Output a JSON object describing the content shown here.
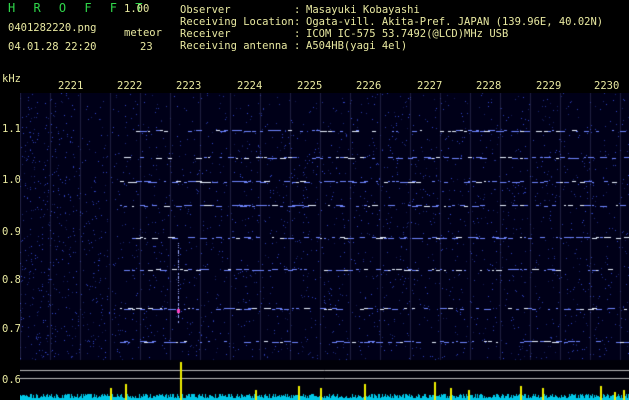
{
  "header": {
    "title": "H R O F F T",
    "version": "1.00",
    "filename": "0401282220.png",
    "datetime": "04.01.28 22:20",
    "meteor_label": "meteor",
    "meteor_count": "23"
  },
  "info": [
    {
      "label": "Observer",
      "value": "Masayuki Kobayashi"
    },
    {
      "label": "Receiving Location",
      "value": "Ogata-vill. Akita-Pref. JAPAN (139.96E, 40.02N)"
    },
    {
      "label": "Receiver",
      "value": "ICOM IC-575 53.7492(@LCD)MHz USB"
    },
    {
      "label": "Receiving antenna",
      "value": "A504HB(yagi 4el)"
    }
  ],
  "colon": ":",
  "spectrogram": {
    "frequency_unit": "kHz",
    "time_labels": [
      "2221",
      "2222",
      "2223",
      "2224",
      "2225",
      "2226",
      "2227",
      "2228",
      "2229",
      "2230"
    ],
    "frequency_labels": [
      "1.1",
      "1.0",
      "0.9",
      "0.8",
      "0.7",
      "0.6"
    ],
    "colors": {
      "background": "#000018",
      "noise": "#2b3fd8",
      "echo": "#e8f0ff",
      "baseline": "#00c8e8",
      "spike": "#f0f000"
    }
  }
}
